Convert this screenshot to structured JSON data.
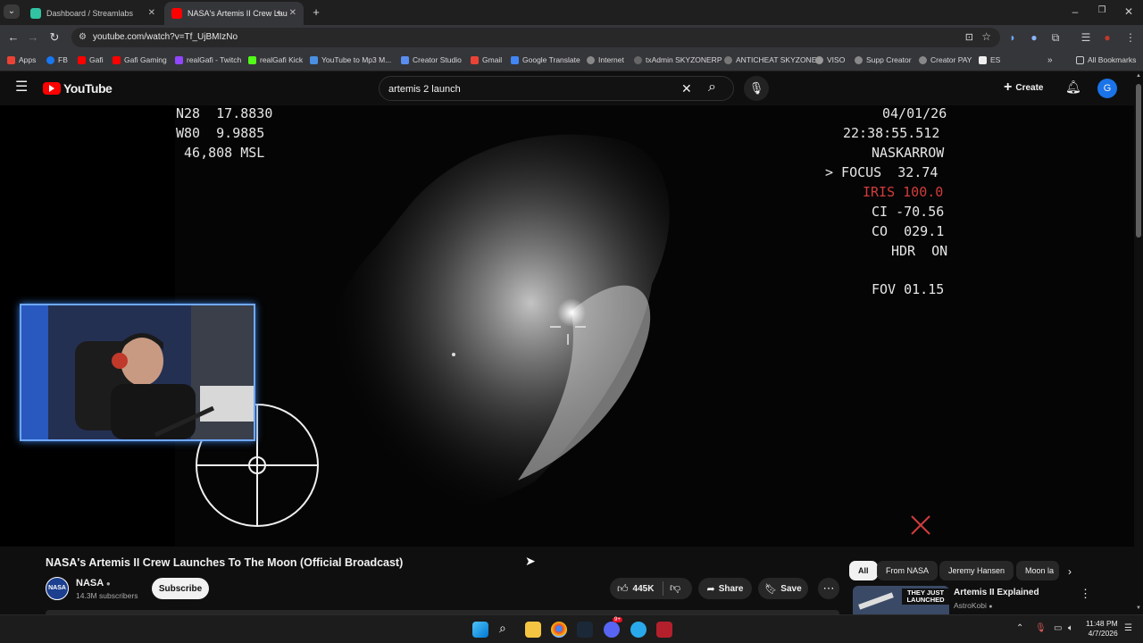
{
  "browser": {
    "tabs": [
      {
        "title": "Dashboard / Streamlabs"
      },
      {
        "title": "NASA's Artemis II Crew Lau"
      }
    ],
    "url": "youtube.com/watch?v=Tf_UjBMIzNo",
    "bookmarks": [
      "Apps",
      "FB",
      "Gafi",
      "Gafi Gaming",
      "realGafi - Twitch",
      "realGafi Kick",
      "YouTube to Mp3 M...",
      "Creator Studio",
      "Gmail",
      "Google Translate",
      "Internet",
      "txAdmin SKYZONERP",
      "ANTICHEAT SKYZONE",
      "VISO",
      "Supp Creator",
      "Creator PAY",
      "ES"
    ],
    "all_bookmarks": "All Bookmarks"
  },
  "youtube": {
    "logo": "YouTube",
    "search_value": "artemis 2 launch",
    "create_label": "Create",
    "avatar_letter": "G"
  },
  "video_overlay": {
    "lat": "N28  17.8830",
    "lon": "W80  9.9885",
    "alt": " 46,808 MSL",
    "date": "04/01/26",
    "time": "22:38:55.512",
    "cam": "NASKARROW",
    "focus": "> FOCUS  32.74",
    "iris": "IRIS 100.0",
    "ci": "CI -70.56",
    "co": "CO  029.1",
    "hdr": "HDR  ON",
    "fov": "FOV 01.15"
  },
  "video_info": {
    "title": "NASA's Artemis II Crew Launches To The Moon (Official Broadcast)",
    "channel": "NASA",
    "subscribers": "14.3M subscribers",
    "subscribe_label": "Subscribe",
    "likes": "445K",
    "share_label": "Share",
    "save_label": "Save"
  },
  "sidebar": {
    "chips": [
      "All",
      "From NASA",
      "Jeremy Hansen",
      "Moon la"
    ],
    "rec_title": "Artemis II Explained",
    "rec_channel": "AstroKobi",
    "rec_thumb_text": "THEY JUST LAUNCHED"
  },
  "taskbar": {
    "time": "11:48 PM",
    "date": "4/7/2026",
    "chrome_badge": "9+"
  },
  "colors": {
    "iris": "#d23c3c",
    "yt_red": "#ff0000",
    "webcam_border": "#6fa8ff"
  }
}
